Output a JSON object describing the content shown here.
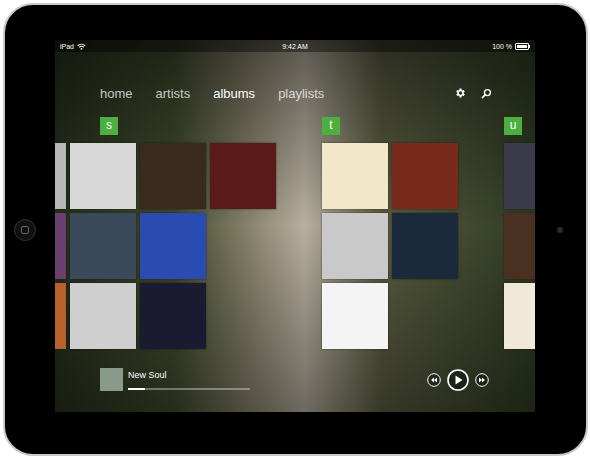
{
  "status_bar": {
    "carrier": "iPad",
    "time": "9:42 AM",
    "battery": "100 %",
    "battery_level": 1
  },
  "nav": {
    "tabs": [
      {
        "label": "home",
        "selected": false
      },
      {
        "label": "artists",
        "selected": false
      },
      {
        "label": "albums",
        "selected": true
      },
      {
        "label": "playlists",
        "selected": false
      }
    ]
  },
  "sections": [
    {
      "letter": "s",
      "columns": [
        [
          {
            "color": "#b8b8b8"
          },
          {
            "color": "#6a3f6e"
          },
          {
            "color": "#b8602e"
          }
        ],
        [
          {
            "color": "#d8d8d8"
          },
          {
            "color": "#3a4a5a"
          },
          {
            "color": "#cfcfcf"
          }
        ],
        [
          {
            "color": "#3a2a1e"
          },
          {
            "color": "#2a4bb0"
          },
          {
            "color": "#1a1a30"
          }
        ],
        [
          {
            "color": "#5a1a1a"
          }
        ]
      ]
    },
    {
      "letter": "t",
      "columns": [
        [
          {
            "color": "#f0e8c8"
          },
          {
            "color": "#c9c9c9"
          },
          {
            "color": "#f4f4f4"
          }
        ],
        [
          {
            "color": "#7a2a1a"
          },
          {
            "color": "#1a2a3a"
          }
        ]
      ]
    },
    {
      "letter": "u",
      "columns": [
        [
          {
            "color": "#3a3a4a"
          },
          {
            "color": "#4a3020"
          },
          {
            "color": "#f0e8d8"
          }
        ]
      ]
    }
  ],
  "now_playing": {
    "title": "New Soul",
    "color": "#8a9a8a",
    "level": 0.14
  }
}
